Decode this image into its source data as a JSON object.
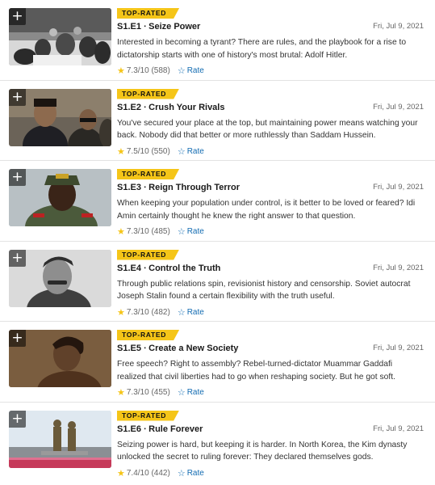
{
  "episodes": [
    {
      "badge": "TOP-RATED",
      "title": "S1.E1 ∙ Seize Power",
      "date": "Fri, Jul 9, 2021",
      "description": "Interested in becoming a tyrant? There are rules, and the playbook for a rise to dictatorship starts with one of history's most brutal: Adolf Hitler.",
      "rating": "7.3/10",
      "votes": "(588)",
      "rate_label": "Rate",
      "add_glyph": "+",
      "star_glyph": "★",
      "rate_glyph": "☆"
    },
    {
      "badge": "TOP-RATED",
      "title": "S1.E2 ∙ Crush Your Rivals",
      "date": "Fri, Jul 9, 2021",
      "description": "You've secured your place at the top, but maintaining power means watching your back. Nobody did that better or more ruthlessly than Saddam Hussein.",
      "rating": "7.5/10",
      "votes": "(550)",
      "rate_label": "Rate",
      "add_glyph": "+",
      "star_glyph": "★",
      "rate_glyph": "☆"
    },
    {
      "badge": "TOP-RATED",
      "title": "S1.E3 ∙ Reign Through Terror",
      "date": "Fri, Jul 9, 2021",
      "description": "When keeping your population under control, is it better to be loved or feared? Idi Amin certainly thought he knew the right answer to that question.",
      "rating": "7.3/10",
      "votes": "(485)",
      "rate_label": "Rate",
      "add_glyph": "+",
      "star_glyph": "★",
      "rate_glyph": "☆"
    },
    {
      "badge": "TOP-RATED",
      "title": "S1.E4 ∙ Control the Truth",
      "date": "Fri, Jul 9, 2021",
      "description": "Through public relations spin, revisionist history and censorship. Soviet autocrat Joseph Stalin found a certain flexibility with the truth useful.",
      "rating": "7.3/10",
      "votes": "(482)",
      "rate_label": "Rate",
      "add_glyph": "+",
      "star_glyph": "★",
      "rate_glyph": "☆"
    },
    {
      "badge": "TOP-RATED",
      "title": "S1.E5 ∙ Create a New Society",
      "date": "Fri, Jul 9, 2021",
      "description": "Free speech? Right to assembly? Rebel-turned-dictator Muammar Gaddafi realized that civil liberties had to go when reshaping society. But he got soft.",
      "rating": "7.3/10",
      "votes": "(455)",
      "rate_label": "Rate",
      "add_glyph": "+",
      "star_glyph": "★",
      "rate_glyph": "☆"
    },
    {
      "badge": "TOP-RATED",
      "title": "S1.E6 ∙ Rule Forever",
      "date": "Fri, Jul 9, 2021",
      "description": "Seizing power is hard, but keeping it is harder. In North Korea, the Kim dynasty unlocked the secret to ruling forever: They declared themselves gods.",
      "rating": "7.4/10",
      "votes": "(442)",
      "rate_label": "Rate",
      "add_glyph": "+",
      "star_glyph": "★",
      "rate_glyph": "☆"
    }
  ],
  "colors": {
    "badge_bg": "#f5c518",
    "link": "#136cb2",
    "star": "#f5c518"
  }
}
